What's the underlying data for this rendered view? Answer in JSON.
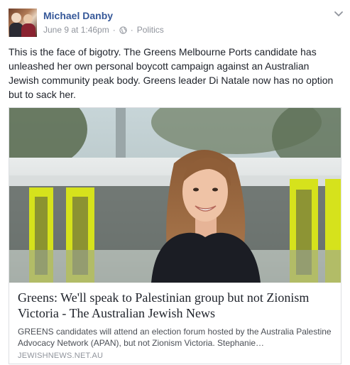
{
  "post": {
    "author": "Michael Danby",
    "timestamp": "June 9 at 1:46pm",
    "separator": "·",
    "privacy_icon": "globe-icon",
    "category": "Politics",
    "text": "This is the face of bigotry. The Greens Melbourne Ports candidate has unleashed her own personal boycott campaign against an Australian Jewish community peak body. Greens leader Di Natale now has no option but to sack her.",
    "menu_icon": "chevron-down-icon"
  },
  "link": {
    "title": "Greens: We'll speak to Palestinian group but not Zionism Victoria - The Australian Jewish News",
    "description": "GREENS candidates will attend an election forum hosted by the Australia Palestine Advocacy Network (APAN), but not Zionism Victoria. Stephanie…",
    "domain": "JEWISHNEWS.NET.AU"
  },
  "colors": {
    "author_link": "#365899",
    "meta_gray": "#90949c",
    "body_text": "#1d2129",
    "card_border": "#dddfe2",
    "tram_yellow": "#d6e21c"
  }
}
